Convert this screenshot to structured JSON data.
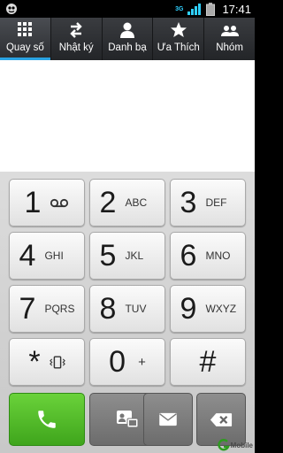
{
  "status": {
    "network": "3G",
    "time": "17:41"
  },
  "tabs": [
    {
      "label": "Quay số",
      "icon": "dialpad-icon",
      "active": true
    },
    {
      "label": "Nhật ký",
      "icon": "call-log-icon",
      "active": false
    },
    {
      "label": "Danh bạ",
      "icon": "contacts-icon",
      "active": false
    },
    {
      "label": "Ưa Thích",
      "icon": "star-icon",
      "active": false
    },
    {
      "label": "Nhóm",
      "icon": "groups-icon",
      "active": false
    }
  ],
  "keys": [
    {
      "digit": "1",
      "sub": ""
    },
    {
      "digit": "2",
      "sub": "ABC"
    },
    {
      "digit": "3",
      "sub": "DEF"
    },
    {
      "digit": "4",
      "sub": "GHI"
    },
    {
      "digit": "5",
      "sub": "JKL"
    },
    {
      "digit": "6",
      "sub": "MNO"
    },
    {
      "digit": "7",
      "sub": "PQRS"
    },
    {
      "digit": "8",
      "sub": "TUV"
    },
    {
      "digit": "9",
      "sub": "WXYZ"
    },
    {
      "digit": "*",
      "sub": ""
    },
    {
      "digit": "0",
      "sub": "+"
    },
    {
      "digit": "#",
      "sub": ""
    }
  ],
  "actions": [
    "call-icon",
    "video-call-icon",
    "message-icon",
    "backspace-icon"
  ],
  "watermark": "Mobile",
  "colors": {
    "accent": "#2aa3e3",
    "call": "#4cb828"
  }
}
